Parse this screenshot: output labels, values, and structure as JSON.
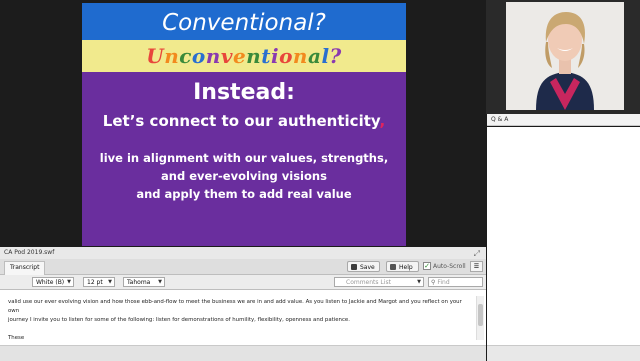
{
  "slide": {
    "title": "Conventional?",
    "subtitle": "Unconventional?",
    "subtitle_colors": [
      "#e8463b",
      "#f28a1e",
      "#3a8a3a",
      "#2a6fd0",
      "#8a3ab0",
      "#e8463b",
      "#f28a1e",
      "#3a8a3a",
      "#2a6fd0",
      "#8a3ab0",
      "#e8463b",
      "#f28a1e",
      "#3a8a3a",
      "#2a6fd0",
      "#8a3ab0"
    ],
    "heading": "Instead:",
    "subheading": "Let’s connect to our authenticity",
    "subheading_mark": ",",
    "line1": "live in alignment with our values, strengths,",
    "line2": "and ever-evolving visions",
    "line3": "and apply them to add real value",
    "colors": {
      "title_band": "#1f6bcf",
      "subtitle_band": "#f1ea8d",
      "body": "#6a2e9e"
    }
  },
  "qa": {
    "title": "Q & A"
  },
  "transcript": {
    "pod_title": "CA Pod 2019.swf",
    "tab": "Transcript",
    "save_label": "Save",
    "help_label": "Help",
    "autoscroll_label": "Auto-Scroll",
    "color_select": "White (B)",
    "size_select": "12 pt",
    "font_select": "Tahoma",
    "comments_select": "Comments List",
    "find_placeholder": "Find",
    "text_line1": "valid use our ever evolving vision and how those ebb-and-flow to meet the business we are in and add value. As you listen to Jackie and Margot and you reflect on your own",
    "text_line2": "journey I invite you to listen for some of the following: listen for demonstrations of humility, flexibility, openness and patience.",
    "text_line3": "These"
  }
}
